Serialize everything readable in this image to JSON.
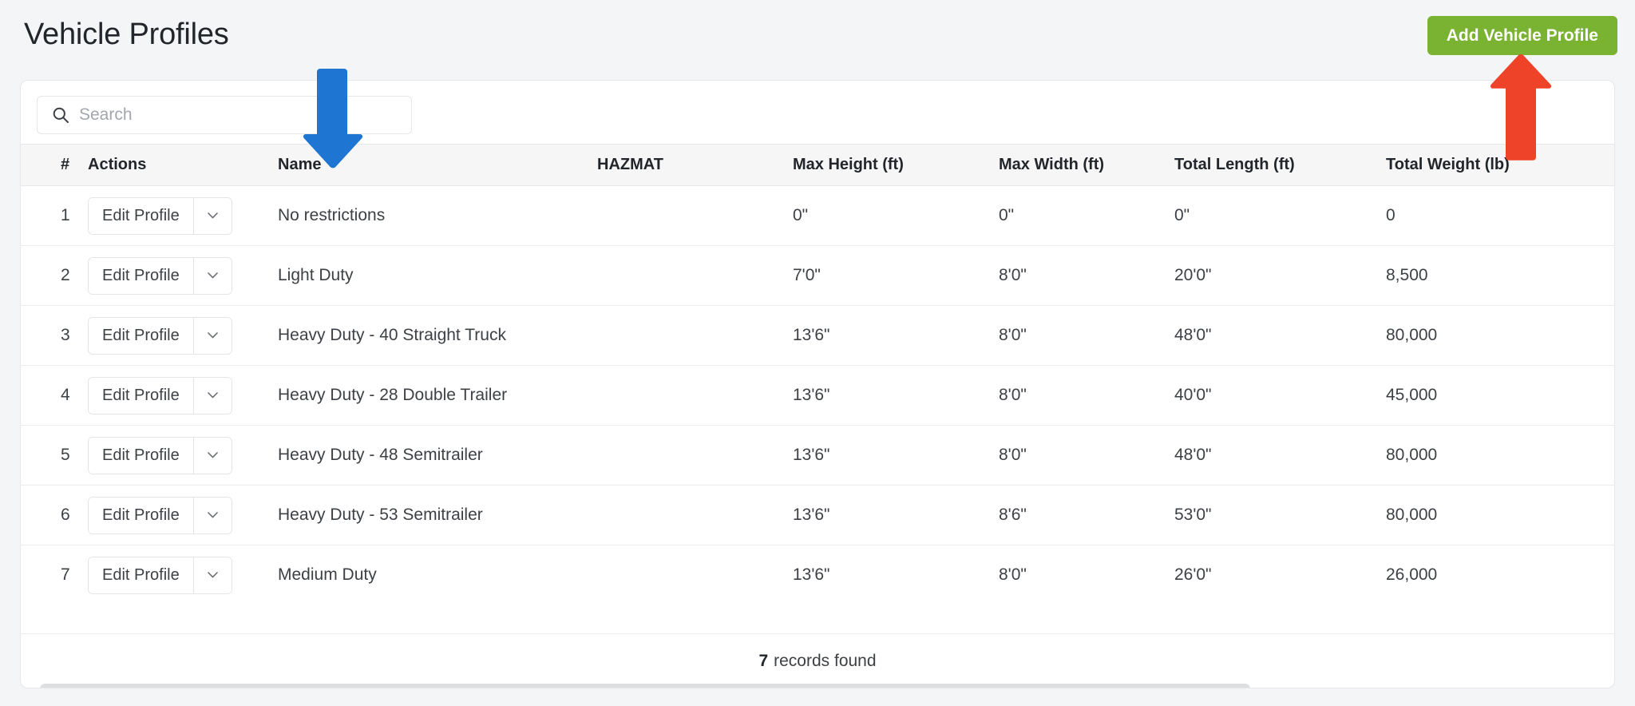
{
  "header": {
    "title": "Vehicle Profiles",
    "add_button_label": "Add Vehicle Profile"
  },
  "search": {
    "placeholder": "Search",
    "value": "",
    "icon": "search-icon"
  },
  "table": {
    "columns": [
      {
        "key": "num",
        "label": "#"
      },
      {
        "key": "act",
        "label": "Actions"
      },
      {
        "key": "name",
        "label": "Name"
      },
      {
        "key": "haz",
        "label": "HAZMAT"
      },
      {
        "key": "mh",
        "label": "Max Height (ft)"
      },
      {
        "key": "mw",
        "label": "Max Width (ft)"
      },
      {
        "key": "tl",
        "label": "Total Length (ft)"
      },
      {
        "key": "tw",
        "label": "Total Weight (lb)"
      }
    ],
    "row_action_label": "Edit Profile",
    "row_action_caret_icon": "chevron-down-icon",
    "rows": [
      {
        "num": "1",
        "name": "No restrictions",
        "haz": "",
        "mh": "0\"",
        "mw": "0\"",
        "tl": "0\"",
        "tw": "0"
      },
      {
        "num": "2",
        "name": "Light Duty",
        "haz": "",
        "mh": "7'0\"",
        "mw": "8'0\"",
        "tl": "20'0\"",
        "tw": "8,500"
      },
      {
        "num": "3",
        "name": "Heavy Duty - 40 Straight Truck",
        "haz": "",
        "mh": "13'6\"",
        "mw": "8'0\"",
        "tl": "48'0\"",
        "tw": "80,000"
      },
      {
        "num": "4",
        "name": "Heavy Duty - 28 Double Trailer",
        "haz": "",
        "mh": "13'6\"",
        "mw": "8'0\"",
        "tl": "40'0\"",
        "tw": "45,000"
      },
      {
        "num": "5",
        "name": "Heavy Duty - 48 Semitrailer",
        "haz": "",
        "mh": "13'6\"",
        "mw": "8'0\"",
        "tl": "48'0\"",
        "tw": "80,000"
      },
      {
        "num": "6",
        "name": "Heavy Duty - 53 Semitrailer",
        "haz": "",
        "mh": "13'6\"",
        "mw": "8'6\"",
        "tl": "53'0\"",
        "tw": "80,000"
      },
      {
        "num": "7",
        "name": "Medium Duty",
        "haz": "",
        "mh": "13'6\"",
        "mw": "8'0\"",
        "tl": "26'0\"",
        "tw": "26,000"
      }
    ]
  },
  "footer": {
    "count": "7",
    "label": "records found"
  },
  "annotations": [
    {
      "name": "blue-down-arrow",
      "direction": "down",
      "color": "#1f76d2",
      "points_at": "Name"
    },
    {
      "name": "red-up-arrow",
      "direction": "up",
      "color": "#ee4328",
      "points_at": "Add Vehicle Profile"
    }
  ],
  "colors": {
    "page_background": "#f4f5f7",
    "card_background": "#ffffff",
    "add_button": "#7ab231",
    "blue_arrow": "#1f76d2",
    "red_arrow": "#ee4328",
    "table_header_background": "#f6f6f7"
  }
}
